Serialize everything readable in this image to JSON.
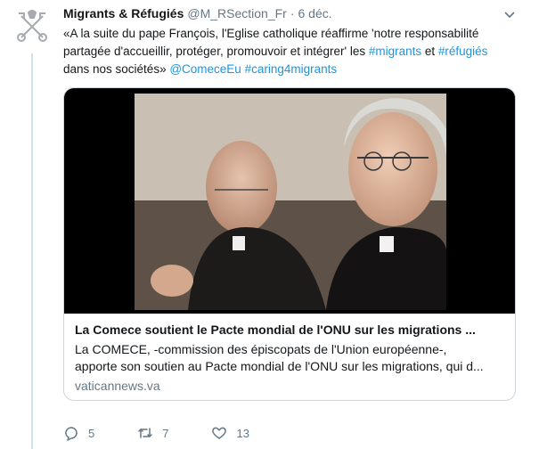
{
  "tweet": {
    "author_name": "Migrants & Réfugiés",
    "handle": "@M_RSection_Fr",
    "separator": "·",
    "time": "6 déc.",
    "text_line1": "«A la suite du pape François, l'Eglise catholique réaffirme 'notre responsabilité",
    "text_line2_a": "partagée d'accueillir, protéger, promouvoir et intégrer' les ",
    "hashtag_migrants": "#migrants",
    "text_line2_b": " et ",
    "hashtag_refugies": "#réfugiés",
    "text_line3_a": "dans nos sociétés» ",
    "mention": "@ComeceEu",
    "hashtag_caring": "#caring4migrants"
  },
  "card": {
    "title": "La Comece soutient le Pacte mondial de l'ONU sur les migrations ...",
    "desc_line1": "La COMECE, -commission des épiscopats de l'Union européenne-,",
    "desc_line2": "apporte son soutien au Pacte mondial de l'ONU sur les migrations, qui d...",
    "domain": "vaticannews.va"
  },
  "actions": {
    "reply_count": "5",
    "retweet_count": "7",
    "like_count": "13"
  },
  "icons": {
    "avatar": "papal-keys-icon",
    "caret": "chevron-down-icon",
    "reply": "reply-icon",
    "retweet": "retweet-icon",
    "like": "heart-icon"
  },
  "colors": {
    "link": "#1b95e0",
    "secondary_text": "#657786",
    "thread_line": "#cfe1f0"
  }
}
